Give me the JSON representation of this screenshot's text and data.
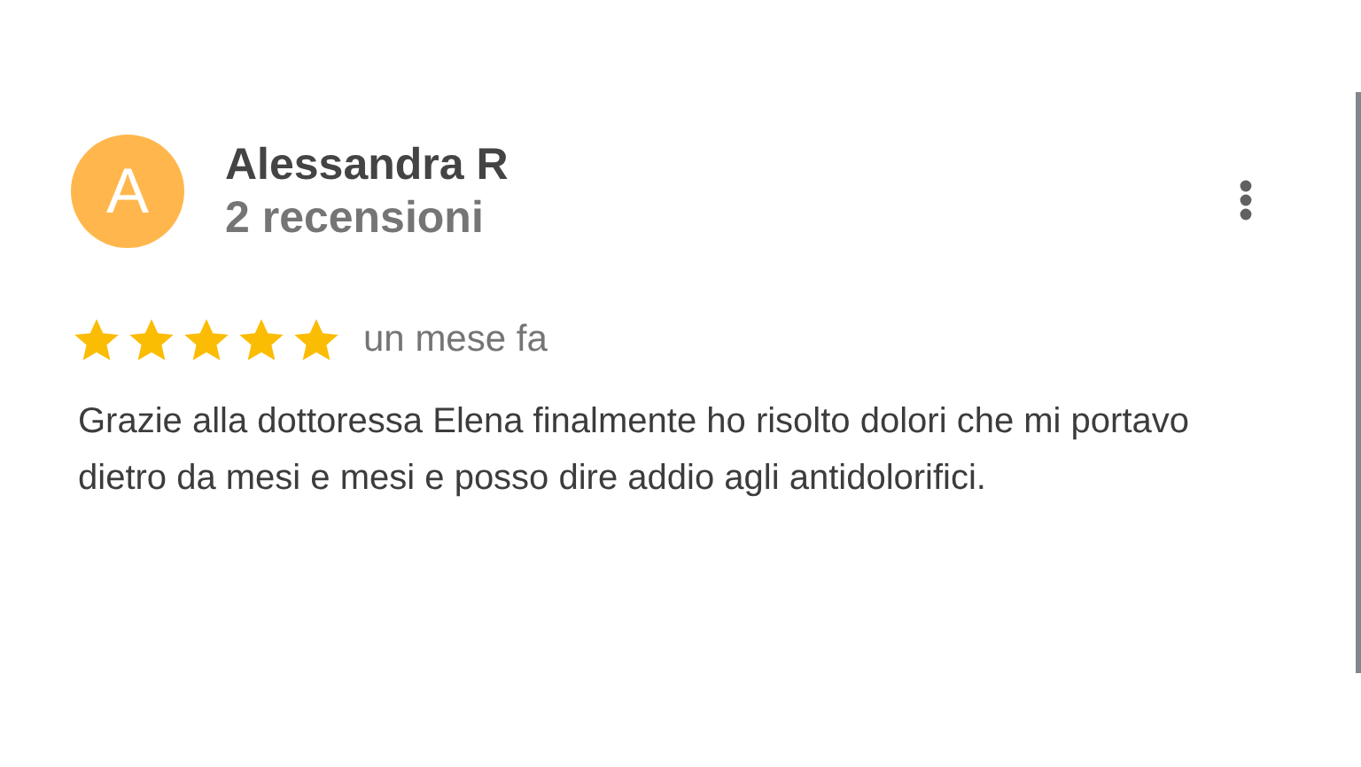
{
  "review": {
    "avatar_letter": "A",
    "author": "Alessandra R",
    "review_count": "2 recensioni",
    "stars": 5,
    "time": "un mese fa",
    "text": "Grazie alla dottoressa Elena finalmente ho risolto dolori che mi portavo dietro da mesi e mesi e posso dire addio agli antidolorifici."
  }
}
